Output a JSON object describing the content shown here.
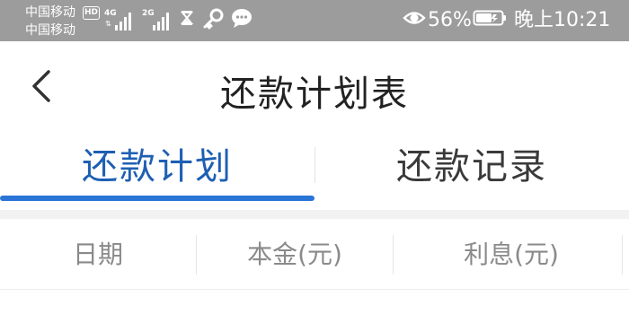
{
  "status_bar": {
    "carrier1": "中国移动",
    "carrier2": "中国移动",
    "hd": "HD",
    "net1": "4G",
    "net2": "2G",
    "battery_percent": "56%",
    "time": "晚上10:21",
    "icons": [
      "hourglass-icon",
      "key-icon",
      "chat-bubble-icon",
      "eye-icon",
      "battery-icon"
    ]
  },
  "header": {
    "back_icon": "chevron-left-icon",
    "title": "还款计划表"
  },
  "tabs": [
    {
      "label": "还款计划",
      "active": true
    },
    {
      "label": "还款记录",
      "active": false
    }
  ],
  "table": {
    "columns": [
      "日期",
      "本金(元)",
      "利息(元)"
    ]
  },
  "colors": {
    "status_bg": "#9c9c9c",
    "accent": "#2a74d8",
    "active_tab_text": "#1e5fb3",
    "header_text": "#8a8a8a"
  }
}
